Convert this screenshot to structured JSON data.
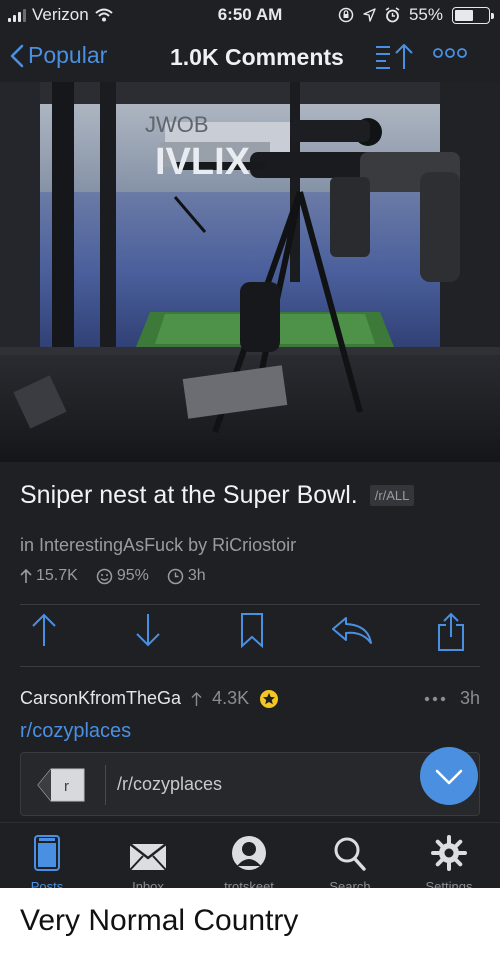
{
  "status": {
    "carrier": "Verizon",
    "time": "6:50 AM",
    "battery": "55%",
    "battery_level": 0.55
  },
  "nav": {
    "back_label": "Popular",
    "title": "1.0K Comments"
  },
  "post": {
    "title": "Sniper nest at the Super Bowl.",
    "flair": "/r/ALL",
    "meta": "in InterestingAsFuck by RiCriostoir",
    "upvotes": "15.7K",
    "ratio": "95%",
    "age": "3h"
  },
  "comment": {
    "author": "CarsonKfromTheGa",
    "score": "4.3K",
    "age": "3h",
    "text": "r/cozyplaces",
    "card_label": "/r/cozyplaces",
    "card_tag": "r"
  },
  "tabs": [
    {
      "label": "Posts",
      "icon": "posts-icon"
    },
    {
      "label": "Inbox",
      "icon": "mail-icon"
    },
    {
      "label": "trotskeet",
      "icon": "user-icon"
    },
    {
      "label": "Search",
      "icon": "search-icon"
    },
    {
      "label": "Settings",
      "icon": "gear-icon"
    }
  ],
  "caption": "Very Normal Country",
  "colors": {
    "accent": "#4a90e2",
    "background": "#1f2024",
    "secondary_text": "#9a9ba0"
  }
}
